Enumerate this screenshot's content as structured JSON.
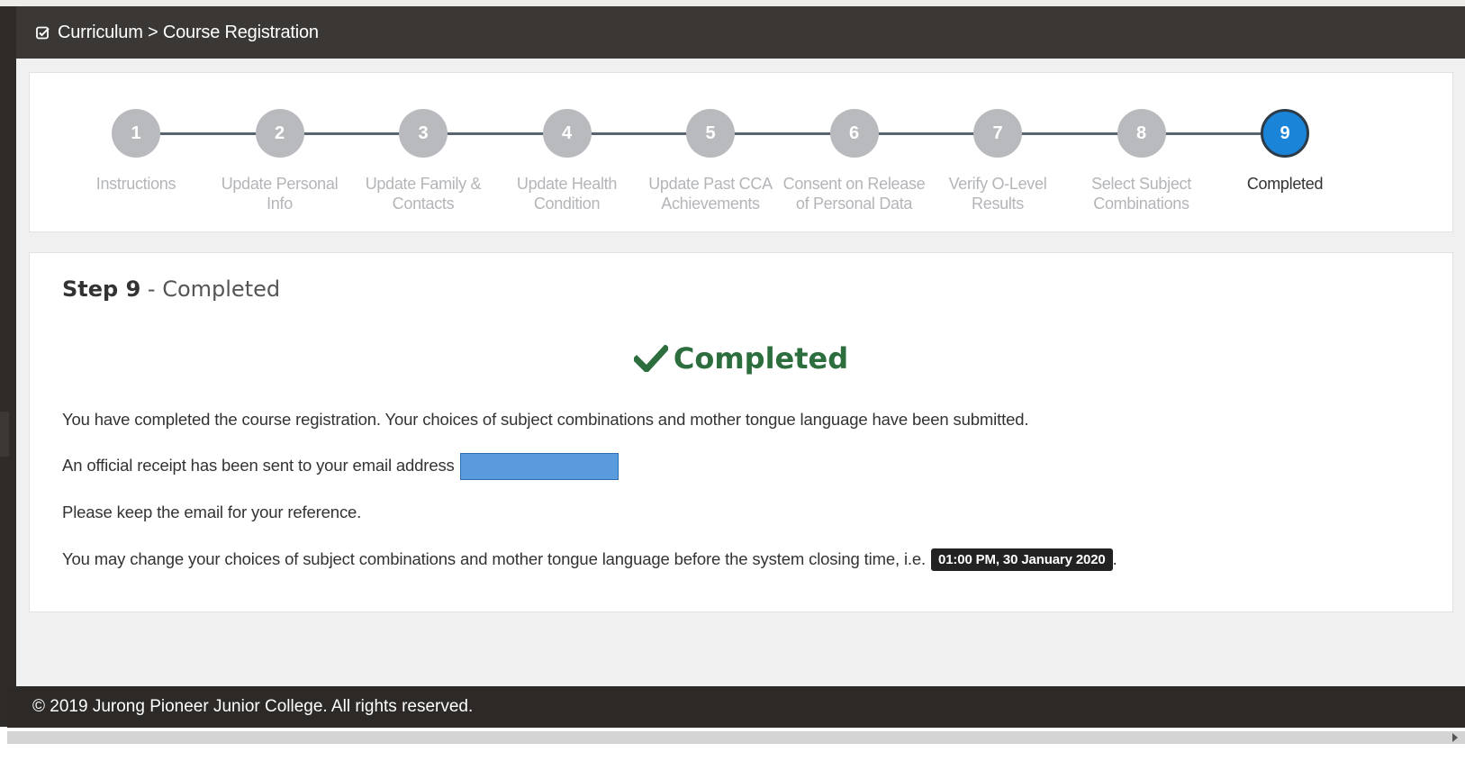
{
  "header": {
    "breadcrumb": "Curriculum > Course Registration",
    "icon": "checkbox-icon"
  },
  "stepper": {
    "current_step": 9,
    "steps": [
      {
        "number": "1",
        "label": "Instructions"
      },
      {
        "number": "2",
        "label": "Update Personal Info"
      },
      {
        "number": "3",
        "label": "Update Family & Contacts"
      },
      {
        "number": "4",
        "label": "Update Health Condition"
      },
      {
        "number": "5",
        "label": "Update Past CCA Achievements"
      },
      {
        "number": "6",
        "label": "Consent on Release of Personal Data"
      },
      {
        "number": "7",
        "label": "Verify O-Level Results"
      },
      {
        "number": "8",
        "label": "Select Subject Combinations"
      },
      {
        "number": "9",
        "label": "Completed"
      }
    ],
    "colors": {
      "inactive": "#b8babd",
      "active": "#1984d8",
      "connector": "#586571"
    }
  },
  "content": {
    "step_label": "Step 9",
    "separator": " - ",
    "step_name": "Completed",
    "status_heading": "Completed",
    "status_color": "#2c6e3d",
    "paragraph1": "You have completed the course registration. Your choices of subject combinations and mother tongue language have been submitted.",
    "paragraph2": "An official receipt has been sent to your email address",
    "paragraph3": "Please keep the email for your reference.",
    "paragraph4": "You may change your choices of subject combinations and mother tongue language before the system closing time, i.e.",
    "closing_time": "01:00 PM, 30 January 2020",
    "paragraph4_end": "."
  },
  "footer": {
    "copyright": "© 2019 Jurong Pioneer Junior College. All rights reserved."
  }
}
